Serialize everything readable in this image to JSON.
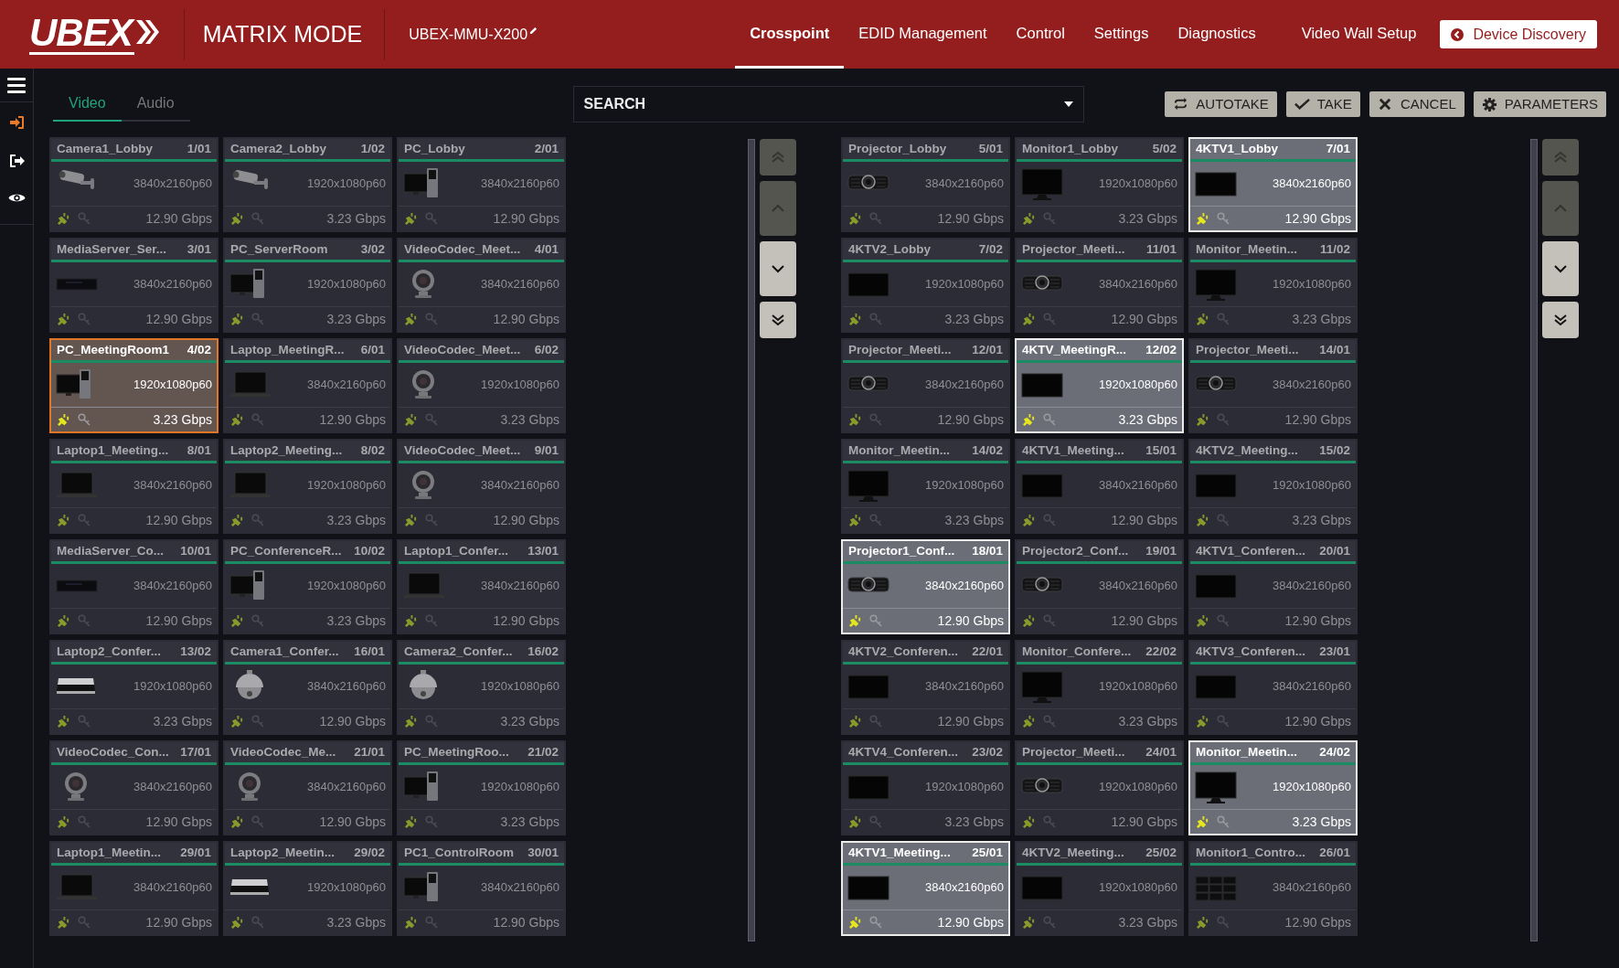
{
  "header": {
    "logo": "UBEX",
    "mode": "MATRIX MODE",
    "device_name": "UBEX-MMU-X200",
    "nav": [
      {
        "label": "Crosspoint",
        "selected": true
      },
      {
        "label": "EDID Management",
        "selected": false
      },
      {
        "label": "Control",
        "selected": false
      },
      {
        "label": "Settings",
        "selected": false
      },
      {
        "label": "Diagnostics",
        "selected": false
      },
      {
        "label": "Video Wall Setup",
        "selected": false
      }
    ],
    "discovery_button": "Device Discovery"
  },
  "tabs": [
    {
      "label": "Video",
      "selected": true
    },
    {
      "label": "Audio",
      "selected": false
    }
  ],
  "search": {
    "label": "SEARCH"
  },
  "actions": [
    {
      "label": "AUTOTAKE",
      "kind": "autotake"
    },
    {
      "label": "TAKE",
      "kind": "take"
    },
    {
      "label": "CANCEL",
      "kind": "cancel"
    },
    {
      "label": "PARAMETERS",
      "kind": "parameters"
    }
  ],
  "sources": [
    {
      "name": "Camera1_Lobby",
      "port": "1/01",
      "resolution": "3840x2160p60",
      "bandwidth": "12.90 Gbps",
      "kind": "camera",
      "selected": false
    },
    {
      "name": "Camera2_Lobby",
      "port": "1/02",
      "resolution": "1920x1080p60",
      "bandwidth": "3.23 Gbps",
      "kind": "camera",
      "selected": false
    },
    {
      "name": "PC_Lobby",
      "port": "2/01",
      "resolution": "3840x2160p60",
      "bandwidth": "12.90 Gbps",
      "kind": "pc",
      "selected": false
    },
    {
      "name": "MediaServer_Ser...",
      "port": "3/01",
      "resolution": "3840x2160p60",
      "bandwidth": "12.90 Gbps",
      "kind": "server",
      "selected": false
    },
    {
      "name": "PC_ServerRoom",
      "port": "3/02",
      "resolution": "1920x1080p60",
      "bandwidth": "3.23 Gbps",
      "kind": "pc",
      "selected": false
    },
    {
      "name": "VideoCodec_Meet...",
      "port": "4/01",
      "resolution": "3840x2160p60",
      "bandwidth": "12.90 Gbps",
      "kind": "codec",
      "selected": false
    },
    {
      "name": "PC_MeetingRoom1",
      "port": "4/02",
      "resolution": "1920x1080p60",
      "bandwidth": "3.23 Gbps",
      "kind": "pc",
      "selected": true
    },
    {
      "name": "Laptop_MeetingR...",
      "port": "6/01",
      "resolution": "3840x2160p60",
      "bandwidth": "12.90 Gbps",
      "kind": "laptop",
      "selected": false
    },
    {
      "name": "VideoCodec_Meet...",
      "port": "6/02",
      "resolution": "1920x1080p60",
      "bandwidth": "3.23 Gbps",
      "kind": "codec",
      "selected": false
    },
    {
      "name": "Laptop1_Meeting...",
      "port": "8/01",
      "resolution": "3840x2160p60",
      "bandwidth": "12.90 Gbps",
      "kind": "laptop",
      "selected": false
    },
    {
      "name": "Laptop2_Meeting...",
      "port": "8/02",
      "resolution": "1920x1080p60",
      "bandwidth": "3.23 Gbps",
      "kind": "laptop",
      "selected": false
    },
    {
      "name": "VideoCodec_Meet...",
      "port": "9/01",
      "resolution": "3840x2160p60",
      "bandwidth": "12.90 Gbps",
      "kind": "codec",
      "selected": false
    },
    {
      "name": "MediaServer_Co...",
      "port": "10/01",
      "resolution": "3840x2160p60",
      "bandwidth": "12.90 Gbps",
      "kind": "server",
      "selected": false
    },
    {
      "name": "PC_ConferenceR...",
      "port": "10/02",
      "resolution": "1920x1080p60",
      "bandwidth": "3.23 Gbps",
      "kind": "pc",
      "selected": false
    },
    {
      "name": "Laptop1_Confer...",
      "port": "13/01",
      "resolution": "3840x2160p60",
      "bandwidth": "12.90 Gbps",
      "kind": "laptop",
      "selected": false
    },
    {
      "name": "Laptop2_Confer...",
      "port": "13/02",
      "resolution": "1920x1080p60",
      "bandwidth": "3.23 Gbps",
      "kind": "notebook",
      "selected": false
    },
    {
      "name": "Camera1_Confer...",
      "port": "16/01",
      "resolution": "3840x2160p60",
      "bandwidth": "12.90 Gbps",
      "kind": "dome",
      "selected": false
    },
    {
      "name": "Camera2_Confer...",
      "port": "16/02",
      "resolution": "1920x1080p60",
      "bandwidth": "3.23 Gbps",
      "kind": "dome",
      "selected": false
    },
    {
      "name": "VideoCodec_Con...",
      "port": "17/01",
      "resolution": "3840x2160p60",
      "bandwidth": "12.90 Gbps",
      "kind": "codec",
      "selected": false
    },
    {
      "name": "VideoCodec_Me...",
      "port": "21/01",
      "resolution": "3840x2160p60",
      "bandwidth": "12.90 Gbps",
      "kind": "codec",
      "selected": false
    },
    {
      "name": "PC_MeetingRoo...",
      "port": "21/02",
      "resolution": "1920x1080p60",
      "bandwidth": "3.23 Gbps",
      "kind": "pc",
      "selected": false
    },
    {
      "name": "Laptop1_Meetin...",
      "port": "29/01",
      "resolution": "3840x2160p60",
      "bandwidth": "12.90 Gbps",
      "kind": "laptop",
      "selected": false
    },
    {
      "name": "Laptop2_Meetin...",
      "port": "29/02",
      "resolution": "1920x1080p60",
      "bandwidth": "3.23 Gbps",
      "kind": "notebook",
      "selected": false
    },
    {
      "name": "PC1_ControlRoom",
      "port": "30/01",
      "resolution": "3840x2160p60",
      "bandwidth": "12.90 Gbps",
      "kind": "pc",
      "selected": false
    }
  ],
  "source_scroll": [
    {
      "kind": "top",
      "disabled": true
    },
    {
      "kind": "up",
      "disabled": true
    },
    {
      "kind": "down",
      "disabled": false
    },
    {
      "kind": "bottom",
      "disabled": false
    }
  ],
  "destinations": [
    {
      "name": "Projector_Lobby",
      "port": "5/01",
      "resolution": "3840x2160p60",
      "bandwidth": "12.90 Gbps",
      "kind": "projector",
      "selected": false
    },
    {
      "name": "Monitor1_Lobby",
      "port": "5/02",
      "resolution": "1920x1080p60",
      "bandwidth": "3.23 Gbps",
      "kind": "monitor",
      "selected": false
    },
    {
      "name": "4KTV1_Lobby",
      "port": "7/01",
      "resolution": "3840x2160p60",
      "bandwidth": "12.90 Gbps",
      "kind": "tv",
      "selected": true
    },
    {
      "name": "4KTV2_Lobby",
      "port": "7/02",
      "resolution": "1920x1080p60",
      "bandwidth": "3.23 Gbps",
      "kind": "tv",
      "selected": false
    },
    {
      "name": "Projector_Meeti...",
      "port": "11/01",
      "resolution": "3840x2160p60",
      "bandwidth": "12.90 Gbps",
      "kind": "projector",
      "selected": false
    },
    {
      "name": "Monitor_Meetin...",
      "port": "11/02",
      "resolution": "1920x1080p60",
      "bandwidth": "3.23 Gbps",
      "kind": "monitor",
      "selected": false
    },
    {
      "name": "Projector_Meeti...",
      "port": "12/01",
      "resolution": "3840x2160p60",
      "bandwidth": "12.90 Gbps",
      "kind": "projector",
      "selected": false
    },
    {
      "name": "4KTV_MeetingR...",
      "port": "12/02",
      "resolution": "1920x1080p60",
      "bandwidth": "3.23 Gbps",
      "kind": "tv",
      "selected": true
    },
    {
      "name": "Projector_Meeti...",
      "port": "14/01",
      "resolution": "3840x2160p60",
      "bandwidth": "12.90 Gbps",
      "kind": "projector",
      "selected": false
    },
    {
      "name": "Monitor_Meetin...",
      "port": "14/02",
      "resolution": "1920x1080p60",
      "bandwidth": "3.23 Gbps",
      "kind": "monitor",
      "selected": false
    },
    {
      "name": "4KTV1_Meeting...",
      "port": "15/01",
      "resolution": "3840x2160p60",
      "bandwidth": "12.90 Gbps",
      "kind": "tv",
      "selected": false
    },
    {
      "name": "4KTV2_Meeting...",
      "port": "15/02",
      "resolution": "1920x1080p60",
      "bandwidth": "3.23 Gbps",
      "kind": "tv",
      "selected": false
    },
    {
      "name": "Projector1_Conf...",
      "port": "18/01",
      "resolution": "3840x2160p60",
      "bandwidth": "12.90 Gbps",
      "kind": "projector",
      "selected": true
    },
    {
      "name": "Projector2_Conf...",
      "port": "19/01",
      "resolution": "3840x2160p60",
      "bandwidth": "12.90 Gbps",
      "kind": "projector",
      "selected": false
    },
    {
      "name": "4KTV1_Conferen...",
      "port": "20/01",
      "resolution": "3840x2160p60",
      "bandwidth": "12.90 Gbps",
      "kind": "tv",
      "selected": false
    },
    {
      "name": "4KTV2_Conferen...",
      "port": "22/01",
      "resolution": "3840x2160p60",
      "bandwidth": "12.90 Gbps",
      "kind": "tv",
      "selected": false
    },
    {
      "name": "Monitor_Confere...",
      "port": "22/02",
      "resolution": "1920x1080p60",
      "bandwidth": "3.23 Gbps",
      "kind": "monitor",
      "selected": false
    },
    {
      "name": "4KTV3_Conferen...",
      "port": "23/01",
      "resolution": "3840x2160p60",
      "bandwidth": "12.90 Gbps",
      "kind": "tv",
      "selected": false
    },
    {
      "name": "4KTV4_Conferen...",
      "port": "23/02",
      "resolution": "1920x1080p60",
      "bandwidth": "3.23 Gbps",
      "kind": "tv",
      "selected": false
    },
    {
      "name": "Projector_Meeti...",
      "port": "24/01",
      "resolution": "1920x1080p60",
      "bandwidth": "12.90 Gbps",
      "kind": "projector",
      "selected": false
    },
    {
      "name": "Monitor_Meetin...",
      "port": "24/02",
      "resolution": "1920x1080p60",
      "bandwidth": "3.23 Gbps",
      "kind": "monitor",
      "selected": true
    },
    {
      "name": "4KTV1_Meeting...",
      "port": "25/01",
      "resolution": "3840x2160p60",
      "bandwidth": "12.90 Gbps",
      "kind": "tv",
      "selected": true
    },
    {
      "name": "4KTV2_Meeting...",
      "port": "25/02",
      "resolution": "1920x1080p60",
      "bandwidth": "3.23 Gbps",
      "kind": "tv",
      "selected": false
    },
    {
      "name": "Monitor1_Contro...",
      "port": "26/01",
      "resolution": "3840x2160p60",
      "bandwidth": "12.90 Gbps",
      "kind": "videowall",
      "selected": false
    }
  ],
  "destination_scroll": [
    {
      "kind": "top",
      "disabled": true
    },
    {
      "kind": "up",
      "disabled": true
    },
    {
      "kind": "down",
      "disabled": false
    },
    {
      "kind": "bottom",
      "disabled": false
    }
  ]
}
